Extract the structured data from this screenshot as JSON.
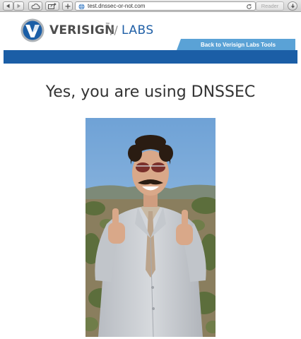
{
  "browser": {
    "url": "test.dnssec-or-not.com",
    "reader_label": "Reader",
    "toolbar_icons": [
      "back-icon",
      "forward-icon",
      "cloud-icon",
      "share-icon",
      "add-icon",
      "globe-icon",
      "reload-icon",
      "download-icon"
    ]
  },
  "header": {
    "brand_name": "VERISIGN",
    "brand_tm": "™",
    "brand_separator": "//",
    "brand_suffix": "LABS",
    "back_link": "Back to Verisign Labs Tools",
    "colors": {
      "brand_blue": "#1b5ea6",
      "link_blue": "#5aa2d6",
      "labs_blue": "#1f5fa6"
    }
  },
  "main": {
    "headline": "Yes, you are using DNSSEC"
  }
}
